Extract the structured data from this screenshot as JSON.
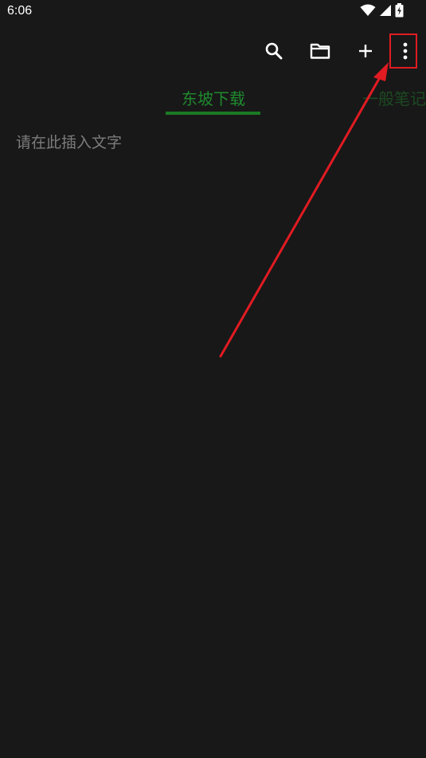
{
  "status_bar": {
    "time": "6:06",
    "icons": [
      "wifi-icon",
      "signal-icon",
      "battery-charging-icon"
    ]
  },
  "toolbar": {
    "actions": [
      "search-icon",
      "folder-icon",
      "add-icon",
      "more-vertical-icon"
    ]
  },
  "tabs": [
    {
      "label": "东坡下载",
      "active": true
    },
    {
      "label": "一般笔记",
      "active": false
    }
  ],
  "editor": {
    "placeholder": "请在此插入文字"
  },
  "colors": {
    "background": "#181818",
    "accent_green": "#1a7a24",
    "annotation_red": "#e11b22",
    "placeholder_gray": "#7c7c7c"
  }
}
